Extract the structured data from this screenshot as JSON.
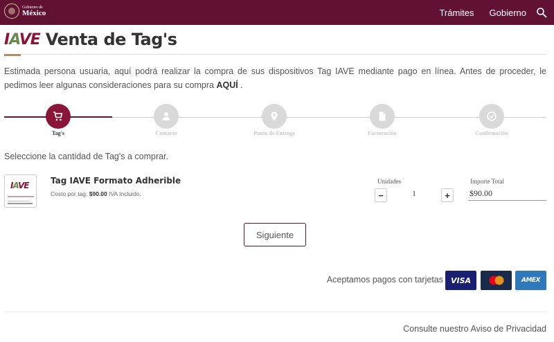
{
  "header": {
    "logo_small": "Gobierno de",
    "logo_big": "México",
    "nav": [
      "Trámites",
      "Gobierno"
    ],
    "bar_color": "#611232"
  },
  "title": {
    "logo_letters": [
      "I",
      "A",
      "VE"
    ],
    "text": "Venta de Tag's"
  },
  "intro": {
    "text": "Estimada persona usuaria, aquí podrá realizar la compra de sus dispositivos Tag IAVE mediante pago en línea. Antes de proceder, le pedimos leer algunas consideraciones para su compra",
    "link": "AQUÍ",
    "end": "."
  },
  "steps": [
    {
      "label": "Tag's",
      "icon": "cart-icon",
      "active": true
    },
    {
      "label": "Contacto",
      "icon": "user-icon",
      "active": false
    },
    {
      "label": "Punto de Entrega",
      "icon": "location-pin-icon",
      "active": false
    },
    {
      "label": "Facturación",
      "icon": "document-icon",
      "active": false
    },
    {
      "label": "Confirmación",
      "icon": "check-circle-icon",
      "active": false
    }
  ],
  "select_prompt": "Seleccione la cantidad de Tag's a comprar.",
  "product": {
    "name": "Tag IAVE Formato Adherible",
    "cost_prefix": "Costo por tag:",
    "cost_value": "$90.00",
    "cost_suffix": "IVA Incluido.",
    "units_label": "Unidades",
    "minus": "−",
    "plus": "+",
    "quantity": "1",
    "total_label": "Importe Total",
    "total_value": "$90.00"
  },
  "next_label": "Siguiente",
  "payments": {
    "text": "Aceptamos pagos con tarjetas",
    "visa": "VISA",
    "amex": "AMEX"
  },
  "footer": {
    "privacy_prefix": "Consulte nuestro",
    "privacy_link": "Aviso de Privacidad"
  }
}
